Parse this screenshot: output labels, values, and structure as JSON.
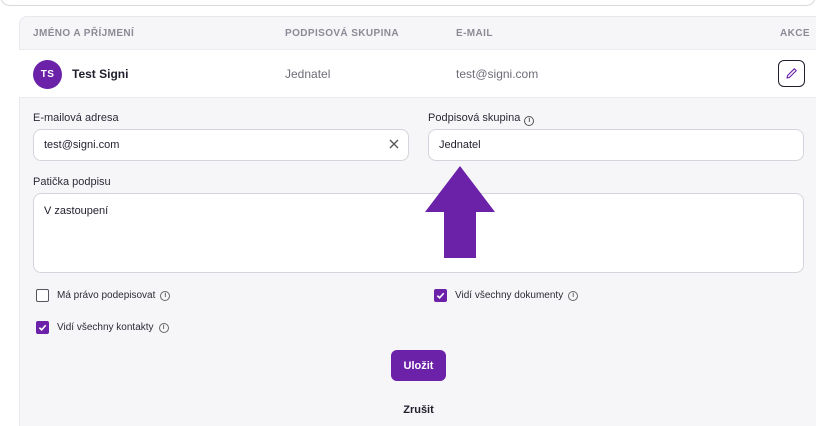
{
  "table": {
    "headers": {
      "name": "JMÉNO A PŘÍJMENÍ",
      "group": "PODPISOVÁ SKUPINA",
      "email": "E-MAIL",
      "actions": "AKCE"
    },
    "rows": [
      {
        "initials": "TS",
        "name": "Test Signi",
        "group": "Jednatel",
        "email": "test@signi.com"
      }
    ]
  },
  "form": {
    "email_label": "E-mailová adresa",
    "email_value": "test@signi.com",
    "group_label": "Podpisová skupina",
    "group_value": "Jednatel",
    "footer_label": "Patička podpisu",
    "footer_value": "V zastoupení",
    "checkboxes": [
      {
        "label": "Má právo podepisovat",
        "checked": false
      },
      {
        "label": "Vidí všechny dokumenty",
        "checked": true
      },
      {
        "label": "Vidí všechny kontakty",
        "checked": true
      }
    ],
    "save_label": "Uložit",
    "cancel_label": "Zrušit"
  },
  "icons": {
    "info": "info-icon",
    "edit": "pencil-icon",
    "clear": "close-icon",
    "check": "check-icon"
  },
  "colors": {
    "accent": "#6b21a8",
    "annotation_arrow": "#6b21a8"
  }
}
